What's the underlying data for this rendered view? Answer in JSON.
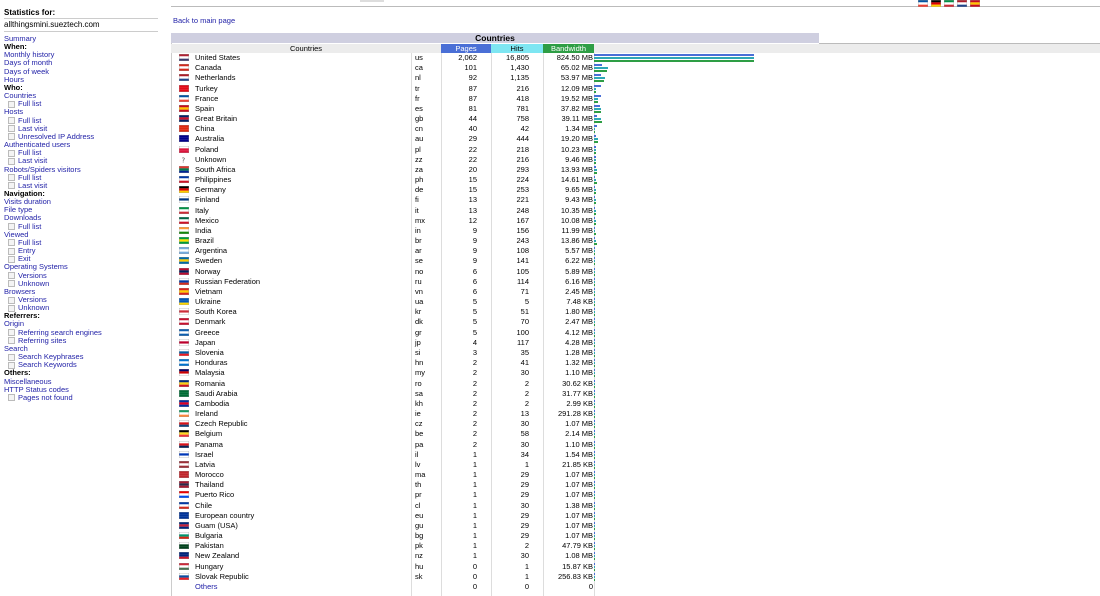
{
  "sidebar": {
    "stats_label": "Statistics for:",
    "domain": "allthingsmini.sueztech.com",
    "menu": [
      {
        "type": "lk",
        "label": "Summary"
      },
      {
        "type": "hd",
        "label": "When:"
      },
      {
        "type": "lk",
        "label": "Monthly history"
      },
      {
        "type": "lk",
        "label": "Days of month"
      },
      {
        "type": "lk",
        "label": "Days of week"
      },
      {
        "type": "lk",
        "label": "Hours"
      },
      {
        "type": "hd",
        "label": "Who:"
      },
      {
        "type": "lk",
        "label": "Countries"
      },
      {
        "type": "sub",
        "label": "Full list"
      },
      {
        "type": "lk",
        "label": "Hosts"
      },
      {
        "type": "sub",
        "label": "Full list"
      },
      {
        "type": "sub",
        "label": "Last visit"
      },
      {
        "type": "sub",
        "label": "Unresolved IP Address"
      },
      {
        "type": "lk",
        "label": "Authenticated users"
      },
      {
        "type": "sub",
        "label": "Full list"
      },
      {
        "type": "sub",
        "label": "Last visit"
      },
      {
        "type": "lk",
        "label": "Robots/Spiders visitors"
      },
      {
        "type": "sub",
        "label": "Full list"
      },
      {
        "type": "sub",
        "label": "Last visit"
      },
      {
        "type": "hd",
        "label": "Navigation:"
      },
      {
        "type": "lk",
        "label": "Visits duration"
      },
      {
        "type": "lk",
        "label": "File type"
      },
      {
        "type": "lk",
        "label": "Downloads"
      },
      {
        "type": "sub",
        "label": "Full list"
      },
      {
        "type": "lk",
        "label": "Viewed"
      },
      {
        "type": "sub",
        "label": "Full list"
      },
      {
        "type": "sub",
        "label": "Entry"
      },
      {
        "type": "sub",
        "label": "Exit"
      },
      {
        "type": "lk",
        "label": "Operating Systems"
      },
      {
        "type": "sub",
        "label": "Versions"
      },
      {
        "type": "sub",
        "label": "Unknown"
      },
      {
        "type": "lk",
        "label": "Browsers"
      },
      {
        "type": "sub",
        "label": "Versions"
      },
      {
        "type": "sub",
        "label": "Unknown"
      },
      {
        "type": "hd",
        "label": "Referrers:"
      },
      {
        "type": "lk",
        "label": "Origin"
      },
      {
        "type": "sub",
        "label": "Referring search engines"
      },
      {
        "type": "sub",
        "label": "Referring sites"
      },
      {
        "type": "lk",
        "label": "Search"
      },
      {
        "type": "sub",
        "label": "Search Keyphrases"
      },
      {
        "type": "sub",
        "label": "Search Keywords"
      },
      {
        "type": "hd",
        "label": "Others:"
      },
      {
        "type": "lk",
        "label": "Miscellaneous"
      },
      {
        "type": "lk",
        "label": "HTTP Status codes"
      },
      {
        "type": "sub",
        "label": "Pages not found"
      }
    ]
  },
  "main": {
    "back_link": "Back to main page",
    "section_title": "Countries",
    "headers": {
      "countries": "Countries",
      "pages": "Pages",
      "hits": "Hits",
      "bandwidth": "Bandwidth"
    },
    "colors": {
      "pages": "#4a6fd6",
      "hits": "#2ea7b5",
      "bandwidth": "#2e9e45",
      "title_bg": "#cfcfe0"
    },
    "rows": [
      {
        "name": "United States",
        "code": "us",
        "pages": "2,062",
        "hits": "16,805",
        "bw": "824.50 MB",
        "p": 2062,
        "h": 16805,
        "b": 824.5,
        "f": [
          "#b22234",
          "#fff",
          "#3c3b6e"
        ]
      },
      {
        "name": "Canada",
        "code": "ca",
        "pages": "101",
        "hits": "1,430",
        "bw": "65.02 MB",
        "p": 101,
        "h": 1430,
        "b": 65.02,
        "f": [
          "#d52b1e",
          "#fff",
          "#d52b1e"
        ]
      },
      {
        "name": "Netherlands",
        "code": "nl",
        "pages": "92",
        "hits": "1,135",
        "bw": "53.97 MB",
        "p": 92,
        "h": 1135,
        "b": 53.97,
        "f": [
          "#ae1c28",
          "#fff",
          "#21468b"
        ]
      },
      {
        "name": "Turkey",
        "code": "tr",
        "pages": "87",
        "hits": "216",
        "bw": "12.09 MB",
        "p": 87,
        "h": 216,
        "b": 12.09,
        "f": [
          "#e30a17",
          "#e30a17",
          "#e30a17"
        ]
      },
      {
        "name": "France",
        "code": "fr",
        "pages": "87",
        "hits": "418",
        "bw": "19.52 MB",
        "p": 87,
        "h": 418,
        "b": 19.52,
        "f": [
          "#0055a4",
          "#fff",
          "#ef4135"
        ]
      },
      {
        "name": "Spain",
        "code": "es",
        "pages": "81",
        "hits": "781",
        "bw": "37.82 MB",
        "p": 81,
        "h": 781,
        "b": 37.82,
        "f": [
          "#c60b1e",
          "#ffc400",
          "#c60b1e"
        ]
      },
      {
        "name": "Great Britain",
        "code": "gb",
        "pages": "44",
        "hits": "758",
        "bw": "39.11 MB",
        "p": 44,
        "h": 758,
        "b": 39.11,
        "f": [
          "#012169",
          "#c8102e",
          "#012169"
        ]
      },
      {
        "name": "China",
        "code": "cn",
        "pages": "40",
        "hits": "42",
        "bw": "1.34 MB",
        "p": 40,
        "h": 42,
        "b": 1.34,
        "f": [
          "#de2910",
          "#de2910",
          "#de2910"
        ]
      },
      {
        "name": "Australia",
        "code": "au",
        "pages": "29",
        "hits": "444",
        "bw": "19.20 MB",
        "p": 29,
        "h": 444,
        "b": 19.2,
        "f": [
          "#00008b",
          "#00008b",
          "#00008b"
        ]
      },
      {
        "name": "Poland",
        "code": "pl",
        "pages": "22",
        "hits": "218",
        "bw": "10.23 MB",
        "p": 22,
        "h": 218,
        "b": 10.23,
        "f": [
          "#fff",
          "#dc143c",
          "#dc143c"
        ]
      },
      {
        "name": "Unknown",
        "code": "zz",
        "pages": "22",
        "hits": "216",
        "bw": "9.46 MB",
        "p": 22,
        "h": 216,
        "b": 9.46,
        "f": [
          "#fff",
          "#fff",
          "#fff"
        ],
        "q": true
      },
      {
        "name": "South Africa",
        "code": "za",
        "pages": "20",
        "hits": "293",
        "bw": "13.93 MB",
        "p": 20,
        "h": 293,
        "b": 13.93,
        "f": [
          "#de3831",
          "#007a4d",
          "#002395"
        ]
      },
      {
        "name": "Philippines",
        "code": "ph",
        "pages": "15",
        "hits": "224",
        "bw": "14.61 MB",
        "p": 15,
        "h": 224,
        "b": 14.61,
        "f": [
          "#0038a8",
          "#fff",
          "#ce1126"
        ]
      },
      {
        "name": "Germany",
        "code": "de",
        "pages": "15",
        "hits": "253",
        "bw": "9.65 MB",
        "p": 15,
        "h": 253,
        "b": 9.65,
        "f": [
          "#000",
          "#dd0000",
          "#ffce00"
        ]
      },
      {
        "name": "Finland",
        "code": "fi",
        "pages": "13",
        "hits": "221",
        "bw": "9.43 MB",
        "p": 13,
        "h": 221,
        "b": 9.43,
        "f": [
          "#fff",
          "#003580",
          "#fff"
        ]
      },
      {
        "name": "Italy",
        "code": "it",
        "pages": "13",
        "hits": "248",
        "bw": "10.35 MB",
        "p": 13,
        "h": 248,
        "b": 10.35,
        "f": [
          "#009246",
          "#fff",
          "#ce2b37"
        ]
      },
      {
        "name": "Mexico",
        "code": "mx",
        "pages": "12",
        "hits": "167",
        "bw": "10.08 MB",
        "p": 12,
        "h": 167,
        "b": 10.08,
        "f": [
          "#006847",
          "#fff",
          "#ce1126"
        ]
      },
      {
        "name": "India",
        "code": "in",
        "pages": "9",
        "hits": "156",
        "bw": "11.99 MB",
        "p": 9,
        "h": 156,
        "b": 11.99,
        "f": [
          "#ff9933",
          "#fff",
          "#138808"
        ]
      },
      {
        "name": "Brazil",
        "code": "br",
        "pages": "9",
        "hits": "243",
        "bw": "13.86 MB",
        "p": 9,
        "h": 243,
        "b": 13.86,
        "f": [
          "#009c3b",
          "#ffdf00",
          "#009c3b"
        ]
      },
      {
        "name": "Argentina",
        "code": "ar",
        "pages": "9",
        "hits": "108",
        "bw": "5.57 MB",
        "p": 9,
        "h": 108,
        "b": 5.57,
        "f": [
          "#74acdf",
          "#fff",
          "#74acdf"
        ]
      },
      {
        "name": "Sweden",
        "code": "se",
        "pages": "9",
        "hits": "141",
        "bw": "6.22 MB",
        "p": 9,
        "h": 141,
        "b": 6.22,
        "f": [
          "#006aa7",
          "#fecc00",
          "#006aa7"
        ]
      },
      {
        "name": "Norway",
        "code": "no",
        "pages": "6",
        "hits": "105",
        "bw": "5.89 MB",
        "p": 6,
        "h": 105,
        "b": 5.89,
        "f": [
          "#ba0c2f",
          "#00205b",
          "#ba0c2f"
        ]
      },
      {
        "name": "Russian Federation",
        "code": "ru",
        "pages": "6",
        "hits": "114",
        "bw": "6.16 MB",
        "p": 6,
        "h": 114,
        "b": 6.16,
        "f": [
          "#fff",
          "#0039a6",
          "#d52b1e"
        ]
      },
      {
        "name": "Vietnam",
        "code": "vn",
        "pages": "6",
        "hits": "71",
        "bw": "2.45 MB",
        "p": 6,
        "h": 71,
        "b": 2.45,
        "f": [
          "#da251d",
          "#ffcd00",
          "#da251d"
        ]
      },
      {
        "name": "Ukraine",
        "code": "ua",
        "pages": "5",
        "hits": "5",
        "bw": "7.48 KB",
        "p": 5,
        "h": 5,
        "b": 0.0073,
        "f": [
          "#0057b7",
          "#0057b7",
          "#ffd700"
        ]
      },
      {
        "name": "South Korea",
        "code": "kr",
        "pages": "5",
        "hits": "51",
        "bw": "1.80 MB",
        "p": 5,
        "h": 51,
        "b": 1.8,
        "f": [
          "#fff",
          "#cd2e3a",
          "#fff"
        ]
      },
      {
        "name": "Denmark",
        "code": "dk",
        "pages": "5",
        "hits": "70",
        "bw": "2.47 MB",
        "p": 5,
        "h": 70,
        "b": 2.47,
        "f": [
          "#c8102e",
          "#fff",
          "#c8102e"
        ]
      },
      {
        "name": "Greece",
        "code": "gr",
        "pages": "5",
        "hits": "100",
        "bw": "4.12 MB",
        "p": 5,
        "h": 100,
        "b": 4.12,
        "f": [
          "#0d5eaf",
          "#fff",
          "#0d5eaf"
        ]
      },
      {
        "name": "Japan",
        "code": "jp",
        "pages": "4",
        "hits": "117",
        "bw": "4.28 MB",
        "p": 4,
        "h": 117,
        "b": 4.28,
        "f": [
          "#fff",
          "#bc002d",
          "#fff"
        ]
      },
      {
        "name": "Slovenia",
        "code": "si",
        "pages": "3",
        "hits": "35",
        "bw": "1.28 MB",
        "p": 3,
        "h": 35,
        "b": 1.28,
        "f": [
          "#fff",
          "#005da4",
          "#ed1c24"
        ]
      },
      {
        "name": "Honduras",
        "code": "hn",
        "pages": "2",
        "hits": "41",
        "bw": "1.32 MB",
        "p": 2,
        "h": 41,
        "b": 1.32,
        "f": [
          "#0073cf",
          "#fff",
          "#0073cf"
        ]
      },
      {
        "name": "Malaysia",
        "code": "my",
        "pages": "2",
        "hits": "30",
        "bw": "1.10 MB",
        "p": 2,
        "h": 30,
        "b": 1.1,
        "f": [
          "#010066",
          "#cc0001",
          "#fff"
        ]
      },
      {
        "name": "Romania",
        "code": "ro",
        "pages": "2",
        "hits": "2",
        "bw": "30.62 KB",
        "p": 2,
        "h": 2,
        "b": 0.03,
        "f": [
          "#002b7f",
          "#fcd116",
          "#ce1126"
        ]
      },
      {
        "name": "Saudi Arabia",
        "code": "sa",
        "pages": "2",
        "hits": "2",
        "bw": "31.77 KB",
        "p": 2,
        "h": 2,
        "b": 0.031,
        "f": [
          "#006c35",
          "#006c35",
          "#006c35"
        ]
      },
      {
        "name": "Cambodia",
        "code": "kh",
        "pages": "2",
        "hits": "2",
        "bw": "2.99 KB",
        "p": 2,
        "h": 2,
        "b": 0.003,
        "f": [
          "#032ea1",
          "#e00025",
          "#032ea1"
        ]
      },
      {
        "name": "Ireland",
        "code": "ie",
        "pages": "2",
        "hits": "13",
        "bw": "291.28 KB",
        "p": 2,
        "h": 13,
        "b": 0.28,
        "f": [
          "#169b62",
          "#fff",
          "#ff883e"
        ]
      },
      {
        "name": "Czech Republic",
        "code": "cz",
        "pages": "2",
        "hits": "30",
        "bw": "1.07 MB",
        "p": 2,
        "h": 30,
        "b": 1.07,
        "f": [
          "#fff",
          "#d7141a",
          "#11457e"
        ]
      },
      {
        "name": "Belgium",
        "code": "be",
        "pages": "2",
        "hits": "58",
        "bw": "2.14 MB",
        "p": 2,
        "h": 58,
        "b": 2.14,
        "f": [
          "#000",
          "#fdda24",
          "#ef3340"
        ]
      },
      {
        "name": "Panama",
        "code": "pa",
        "pages": "2",
        "hits": "30",
        "bw": "1.10 MB",
        "p": 2,
        "h": 30,
        "b": 1.1,
        "f": [
          "#fff",
          "#da121a",
          "#072357"
        ]
      },
      {
        "name": "Israel",
        "code": "il",
        "pages": "1",
        "hits": "34",
        "bw": "1.54 MB",
        "p": 1,
        "h": 34,
        "b": 1.54,
        "f": [
          "#fff",
          "#0038b8",
          "#fff"
        ]
      },
      {
        "name": "Latvia",
        "code": "lv",
        "pages": "1",
        "hits": "1",
        "bw": "21.85 KB",
        "p": 1,
        "h": 1,
        "b": 0.021,
        "f": [
          "#9e3039",
          "#fff",
          "#9e3039"
        ]
      },
      {
        "name": "Morocco",
        "code": "ma",
        "pages": "1",
        "hits": "29",
        "bw": "1.07 MB",
        "p": 1,
        "h": 29,
        "b": 1.07,
        "f": [
          "#c1272d",
          "#c1272d",
          "#c1272d"
        ]
      },
      {
        "name": "Thailand",
        "code": "th",
        "pages": "1",
        "hits": "29",
        "bw": "1.07 MB",
        "p": 1,
        "h": 29,
        "b": 1.07,
        "f": [
          "#a51931",
          "#2d2a4a",
          "#a51931"
        ]
      },
      {
        "name": "Puerto Rico",
        "code": "pr",
        "pages": "1",
        "hits": "29",
        "bw": "1.07 MB",
        "p": 1,
        "h": 29,
        "b": 1.07,
        "f": [
          "#ed0000",
          "#fff",
          "#0050f0"
        ]
      },
      {
        "name": "Chile",
        "code": "cl",
        "pages": "1",
        "hits": "30",
        "bw": "1.38 MB",
        "p": 1,
        "h": 30,
        "b": 1.38,
        "f": [
          "#0039a6",
          "#fff",
          "#d52b1e"
        ]
      },
      {
        "name": "European country",
        "code": "eu",
        "pages": "1",
        "hits": "29",
        "bw": "1.07 MB",
        "p": 1,
        "h": 29,
        "b": 1.07,
        "f": [
          "#003399",
          "#003399",
          "#003399"
        ]
      },
      {
        "name": "Guam (USA)",
        "code": "gu",
        "pages": "1",
        "hits": "29",
        "bw": "1.07 MB",
        "p": 1,
        "h": 29,
        "b": 1.07,
        "f": [
          "#00297b",
          "#c62139",
          "#00297b"
        ]
      },
      {
        "name": "Bulgaria",
        "code": "bg",
        "pages": "1",
        "hits": "29",
        "bw": "1.07 MB",
        "p": 1,
        "h": 29,
        "b": 1.07,
        "f": [
          "#fff",
          "#00966e",
          "#d62612"
        ]
      },
      {
        "name": "Pakistan",
        "code": "pk",
        "pages": "1",
        "hits": "2",
        "bw": "47.79 KB",
        "p": 1,
        "h": 2,
        "b": 0.047,
        "f": [
          "#fff",
          "#01411c",
          "#01411c"
        ]
      },
      {
        "name": "New Zealand",
        "code": "nz",
        "pages": "1",
        "hits": "30",
        "bw": "1.08 MB",
        "p": 1,
        "h": 30,
        "b": 1.08,
        "f": [
          "#00247d",
          "#00247d",
          "#cc142b"
        ]
      },
      {
        "name": "Hungary",
        "code": "hu",
        "pages": "0",
        "hits": "1",
        "bw": "15.87 KB",
        "p": 0,
        "h": 1,
        "b": 0.016,
        "f": [
          "#ce2939",
          "#fff",
          "#477050"
        ]
      },
      {
        "name": "Slovak Republic",
        "code": "sk",
        "pages": "0",
        "hits": "1",
        "bw": "256.83 KB",
        "p": 0,
        "h": 1,
        "b": 0.25,
        "f": [
          "#fff",
          "#0b4ea2",
          "#ee1c25"
        ]
      },
      {
        "name": "Others",
        "code": "",
        "pages": "0",
        "hits": "0",
        "bw": "0",
        "p": 0,
        "h": 0,
        "b": 0,
        "f": null,
        "others": true
      }
    ]
  },
  "lang_flags": [
    [
      "#0055a4",
      "#fff",
      "#ef4135"
    ],
    [
      "#000",
      "#dd0000",
      "#ffce00"
    ],
    [
      "#009246",
      "#fff",
      "#ce2b37"
    ],
    [
      "#ae1c28",
      "#fff",
      "#21468b"
    ],
    [
      "#c60b1e",
      "#ffc400",
      "#c60b1e"
    ]
  ]
}
